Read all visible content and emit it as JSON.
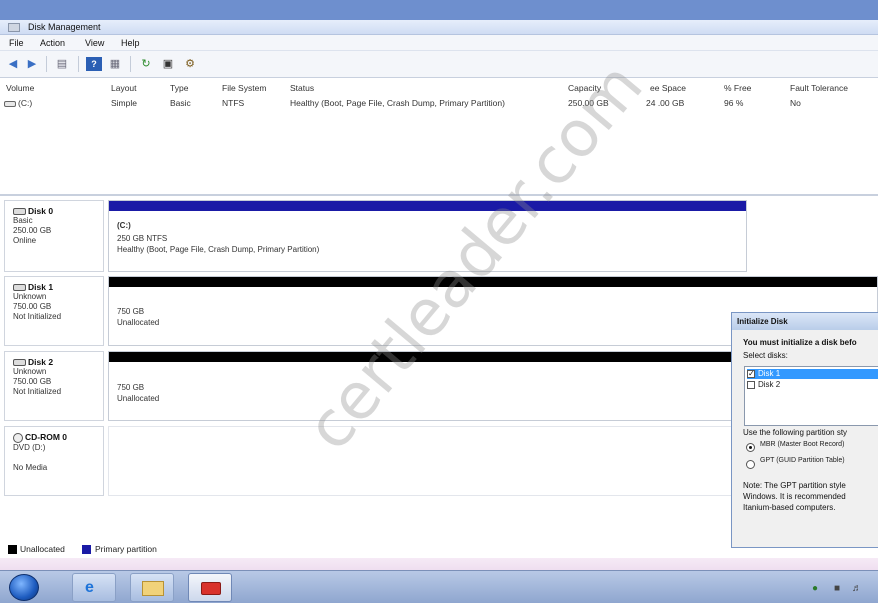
{
  "window": {
    "title": "Disk Management"
  },
  "menu": [
    "File",
    "Action",
    "View",
    "Help"
  ],
  "toolbar": {
    "buttons": [
      "back-icon",
      "forward-icon",
      "disk-list-icon",
      "help-icon",
      "properties-icon",
      "refresh-icon",
      "rescan-icon",
      "settings-icon"
    ]
  },
  "volume_list": {
    "columns": [
      "Volume",
      "Layout",
      "Type",
      "File System",
      "Status",
      "Capacity",
      "ee Space",
      "% Free",
      "Fault Tolerance"
    ],
    "rows": [
      {
        "volume": "(C:)",
        "layout": "Simple",
        "type": "Basic",
        "fs": "NTFS",
        "status": "Healthy (Boot, Page File, Crash Dump, Primary Partition)",
        "capacity": "250.00 GB",
        "free": "24 .00 GB",
        "pct_free": "96 %",
        "fault": "No"
      }
    ]
  },
  "disks": [
    {
      "name": "Disk 0",
      "kind": "Basic",
      "size": "250.00 GB",
      "state": "Online",
      "partition": {
        "title": "(C:)",
        "detail": "250 GB NTFS",
        "status": "Healthy (Boot, Page File, Crash Dump, Primary Partition)"
      }
    },
    {
      "name": "Disk 1",
      "kind": "Unknown",
      "size": "750.00 GB",
      "state": "Not Initialized",
      "partition": {
        "size": "750 GB",
        "status": "Unallocated"
      }
    },
    {
      "name": "Disk 2",
      "kind": "Unknown",
      "size": "750.00 GB",
      "state": "Not Initialized",
      "partition": {
        "size": "750 GB",
        "status": "Unallocated"
      }
    },
    {
      "name": "CD-ROM 0",
      "kind": "DVD (D:)",
      "state": "No Media"
    }
  ],
  "legend": {
    "unallocated": "Unallocated",
    "primary": "Primary partition"
  },
  "colors": {
    "primary": "#1a1aa6",
    "unallocated": "#000000",
    "selection": "#3399ff"
  },
  "dialog": {
    "title": "Initialize Disk",
    "intro": "You must initialize a disk befo",
    "select_label": "Select disks:",
    "disks": [
      {
        "label": "Disk 1",
        "checked": true
      },
      {
        "label": "Disk 2",
        "checked": false
      }
    ],
    "style_label": "Use the following partition sty",
    "options": [
      {
        "label": "MBR (Master Boot Record)",
        "selected": true
      },
      {
        "label": "GPT (GUID Partition Table)",
        "selected": false
      }
    ],
    "note": [
      "Note: The GPT partition style",
      "Windows. It is recommended",
      "Itanium-based computers."
    ]
  },
  "watermark": "certleader.com"
}
